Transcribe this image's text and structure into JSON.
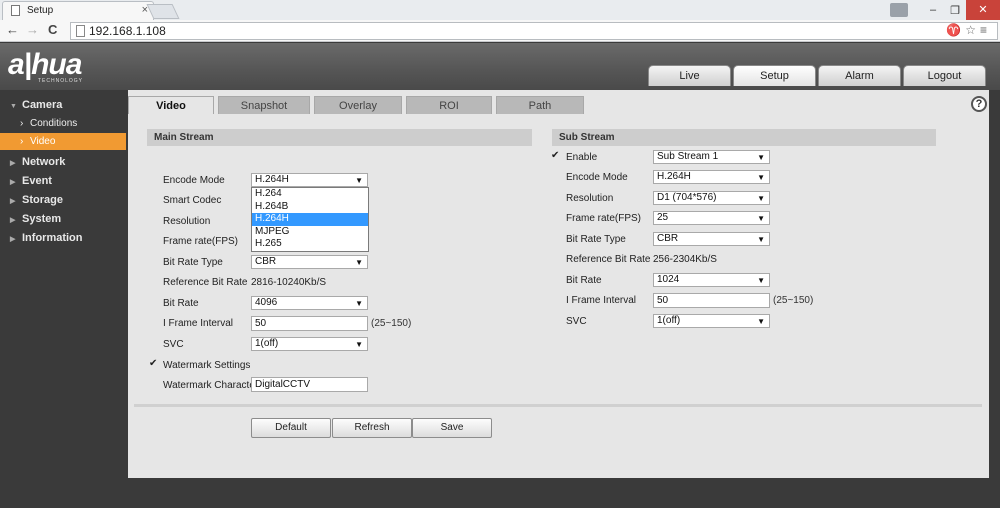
{
  "browser": {
    "tab_title": "Setup",
    "tab_close": "×",
    "url": "192.168.1.108",
    "toolbar_right": "♈☆≡",
    "win_min": "–",
    "win_restore": "❐",
    "win_close": "✕",
    "back": "←",
    "forward": "→",
    "reload": "C"
  },
  "logo": {
    "main": "a|hua",
    "sub": "TECHNOLOGY"
  },
  "top_nav": [
    "Live",
    "Setup",
    "Alarm",
    "Logout"
  ],
  "sidebar": {
    "groups": [
      {
        "label": "Camera",
        "expanded": true
      },
      {
        "label": "Network"
      },
      {
        "label": "Event"
      },
      {
        "label": "Storage"
      },
      {
        "label": "System"
      },
      {
        "label": "Information"
      }
    ],
    "camera_items": [
      "Conditions",
      "Video"
    ],
    "active_item": "Video"
  },
  "tabs": [
    "Video",
    "Snapshot",
    "Overlay",
    "ROI",
    "Path"
  ],
  "help": "?",
  "main_stream": {
    "title": "Main Stream",
    "encode_mode_label": "Encode Mode",
    "encode_mode": "H.264H",
    "encode_options": [
      "H.264",
      "H.264B",
      "H.264H",
      "MJPEG",
      "H.265"
    ],
    "smart_codec_label": "Smart Codec",
    "resolution_label": "Resolution",
    "frame_rate_label": "Frame rate(FPS)",
    "bit_rate_type_label": "Bit Rate Type",
    "bit_rate_type": "CBR",
    "ref_bit_rate_label": "Reference Bit Rate",
    "ref_bit_rate": "2816-10240Kb/S",
    "bit_rate_label": "Bit Rate",
    "bit_rate": "4096",
    "iframe_label": "I Frame Interval",
    "iframe": "50",
    "iframe_range": "(25~150)",
    "svc_label": "SVC",
    "svc": "1(off)",
    "watermark_settings_label": "Watermark Settings",
    "watermark_char_label": "Watermark Character",
    "watermark_char": "DigitalCCTV"
  },
  "sub_stream": {
    "title": "Sub Stream",
    "enable_label": "Enable",
    "enable_value": "Sub Stream 1",
    "encode_mode_label": "Encode Mode",
    "encode_mode": "H.264H",
    "resolution_label": "Resolution",
    "resolution": "D1 (704*576)",
    "frame_rate_label": "Frame rate(FPS)",
    "frame_rate": "25",
    "bit_rate_type_label": "Bit Rate Type",
    "bit_rate_type": "CBR",
    "ref_bit_rate_label": "Reference Bit Rate",
    "ref_bit_rate": "256-2304Kb/S",
    "bit_rate_label": "Bit Rate",
    "bit_rate": "1024",
    "iframe_label": "I Frame Interval",
    "iframe": "50",
    "iframe_range": "(25~150)",
    "svc_label": "SVC",
    "svc": "1(off)"
  },
  "buttons": {
    "default": "Default",
    "refresh": "Refresh",
    "save": "Save"
  },
  "colors": {
    "active_orange": "#f19a32",
    "selected_blue": "#3399ff"
  },
  "icons": {
    "check": "✔",
    "arrow": "▼",
    "chevron": "›",
    "triangle": "▶"
  }
}
